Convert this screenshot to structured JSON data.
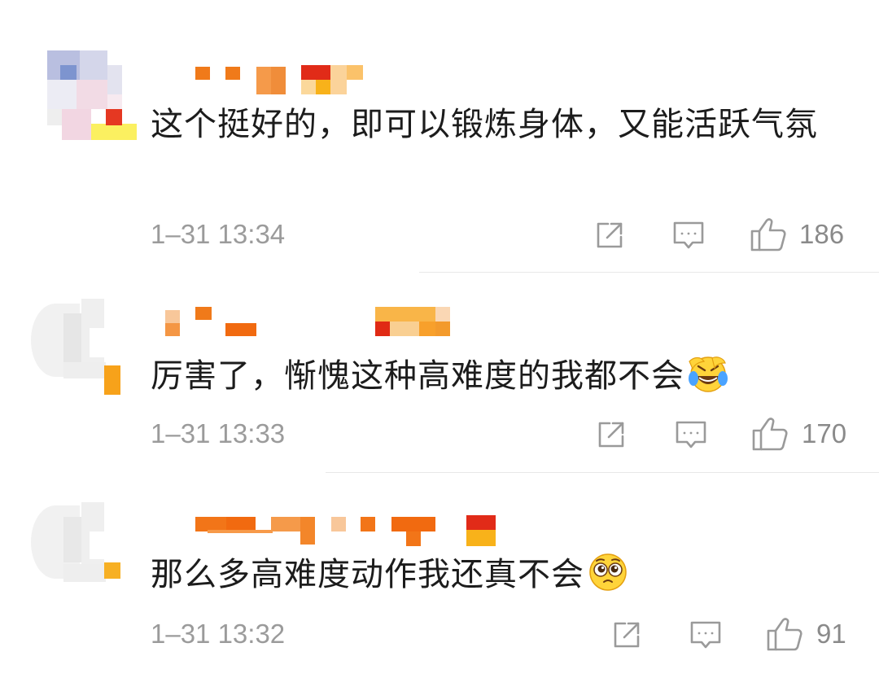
{
  "comments": [
    {
      "text": "这个挺好的，即可以锻炼身体，又能活跃气氛",
      "time": "1–31 13:34",
      "likes": "186",
      "emoji": ""
    },
    {
      "text": "厉害了，惭愧这种高难度的我都不会",
      "time": "1–31 13:33",
      "likes": "170",
      "emoji": "laughing-crying-emoji"
    },
    {
      "text": "那么多高难度动作我还真不会",
      "time": "1–31 13:32",
      "likes": "91",
      "emoji": "pleading-face-emoji"
    }
  ],
  "icons": {
    "share": "share-icon",
    "reply": "comment-icon",
    "like": "thumbs-up-icon"
  },
  "colors": {
    "text": "#1c1c1c",
    "meta": "#9b9b9b",
    "icon": "#9a9a9a",
    "divider": "#e8e8e8"
  }
}
